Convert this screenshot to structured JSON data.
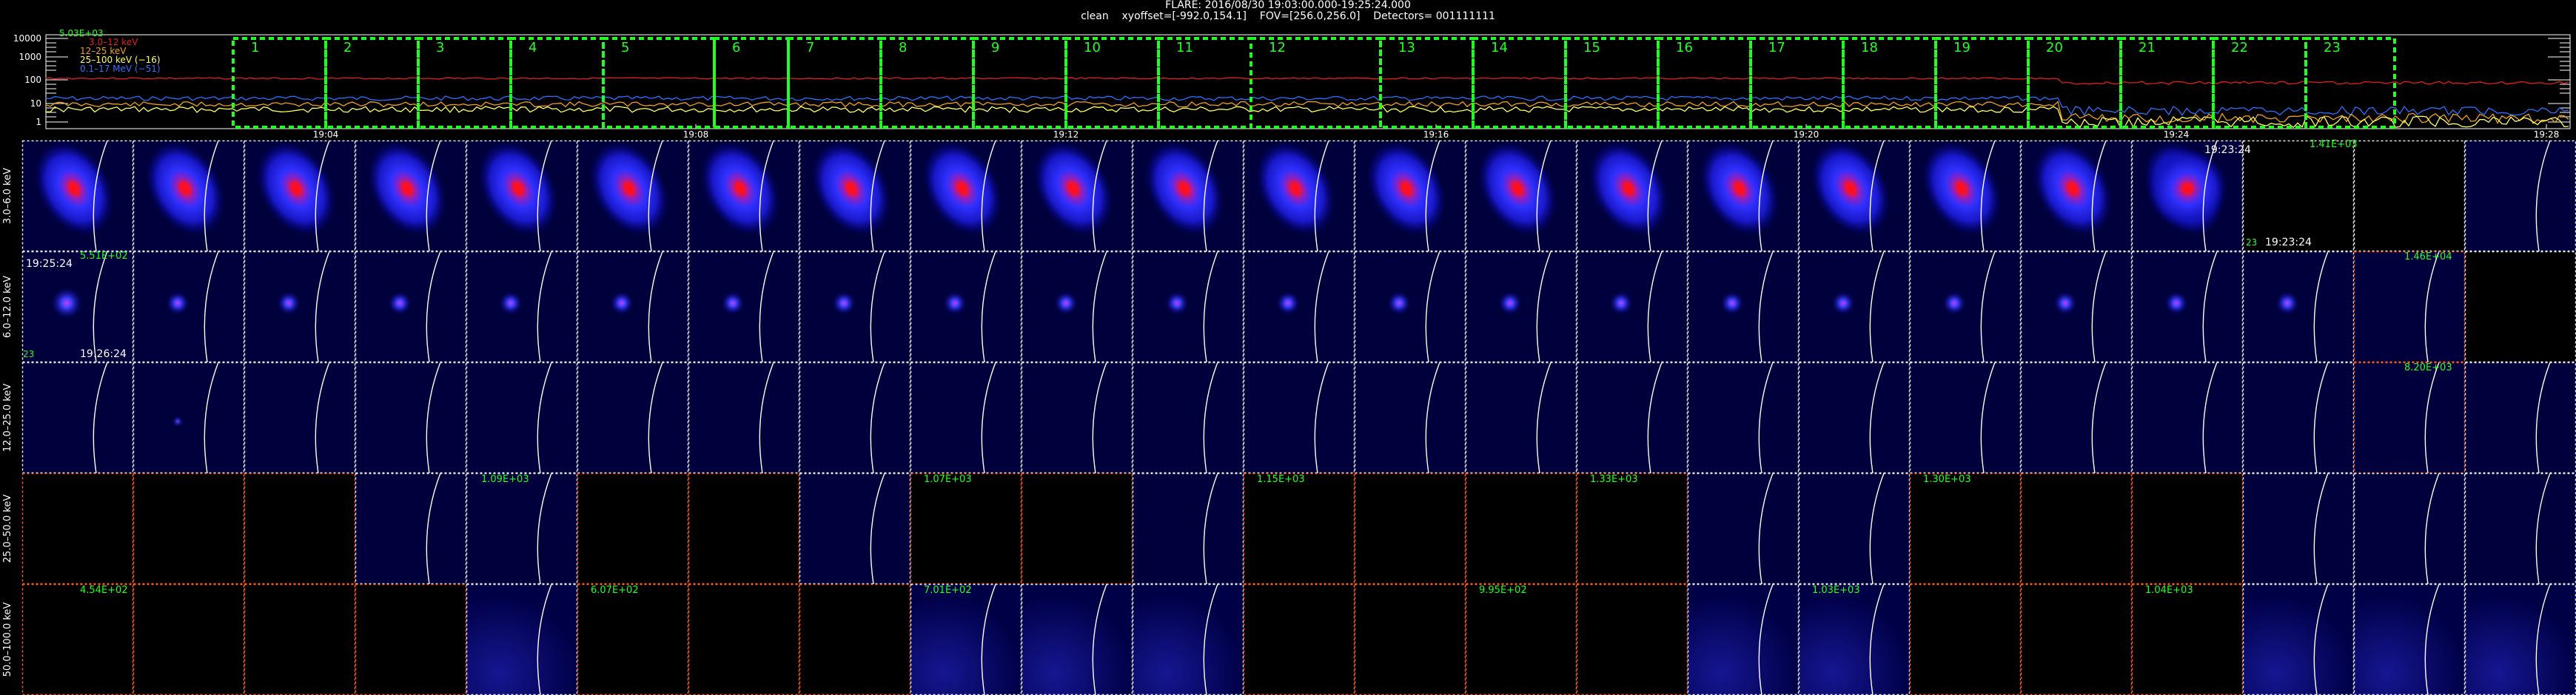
{
  "header": {
    "title": "FLARE: 2016/08/30 19:03:00.000-19:25:24.000",
    "info": "clean    xyoffset=[-992.0,154.1]    FOV=[256.0,256.0]    Detectors= 001111111"
  },
  "timeseries": {
    "peak_label": "5.03E+03",
    "legend": [
      {
        "text": "3.0–12 keV",
        "color": "#e02020"
      },
      {
        "text": "12–25 keV",
        "color": "#f0a020"
      },
      {
        "text": "25–100 keV (−16)",
        "color": "#ffff60"
      },
      {
        "text": "0.1–17 MeV (−51)",
        "color": "#3070ff"
      }
    ],
    "y_ticks": [
      "10000",
      "1000",
      "100",
      "10",
      "1"
    ],
    "x_ticks": [
      "19:04",
      "19:08",
      "19:12",
      "19:16",
      "19:20",
      "19:24",
      "19:28"
    ],
    "boxes": [
      "1",
      "2",
      "3",
      "4",
      "5",
      "6",
      "7",
      "8",
      "9",
      "10",
      "11",
      "12",
      "13",
      "14",
      "15",
      "16",
      "17",
      "18",
      "19",
      "20",
      "21",
      "22",
      "23"
    ],
    "box_color": "#20ff20"
  },
  "grid": {
    "row_labels": [
      "3.0–6.0 keV",
      "6.0–12.0 keV",
      "12.0–25.0 keV",
      "25.0–50.0 keV",
      "50.0–100.0 keV"
    ],
    "notes": {
      "r0_c20_time": "19:23:24",
      "r0_c20_max": "1.41E+03",
      "r0_c20_idx": "23",
      "r0_c20_time2": "19:23:24",
      "r1_c0_time": "19:25:24",
      "r1_c0_max": "5.51E+02",
      "r1_c0_idx": "23",
      "r1_c0_time2": "19:26:24",
      "r1_c21_max": "1.46E+04",
      "r2_c21_max": "8.20E+03",
      "r3_c4": "1.09E+03",
      "r3_c8": "1.07E+03",
      "r3_c11": "1.15E+03",
      "r3_c14": "1.33E+03",
      "r3_c17": "1.30E+03",
      "r4_c0": "4.54E+02",
      "r4_c5": "6.07E+02",
      "r4_c8": "7.01E+02",
      "r4_c12": "9.95E+02",
      "r4_c15": "1.03E+03",
      "r4_c18": "1.04E+03"
    }
  }
}
